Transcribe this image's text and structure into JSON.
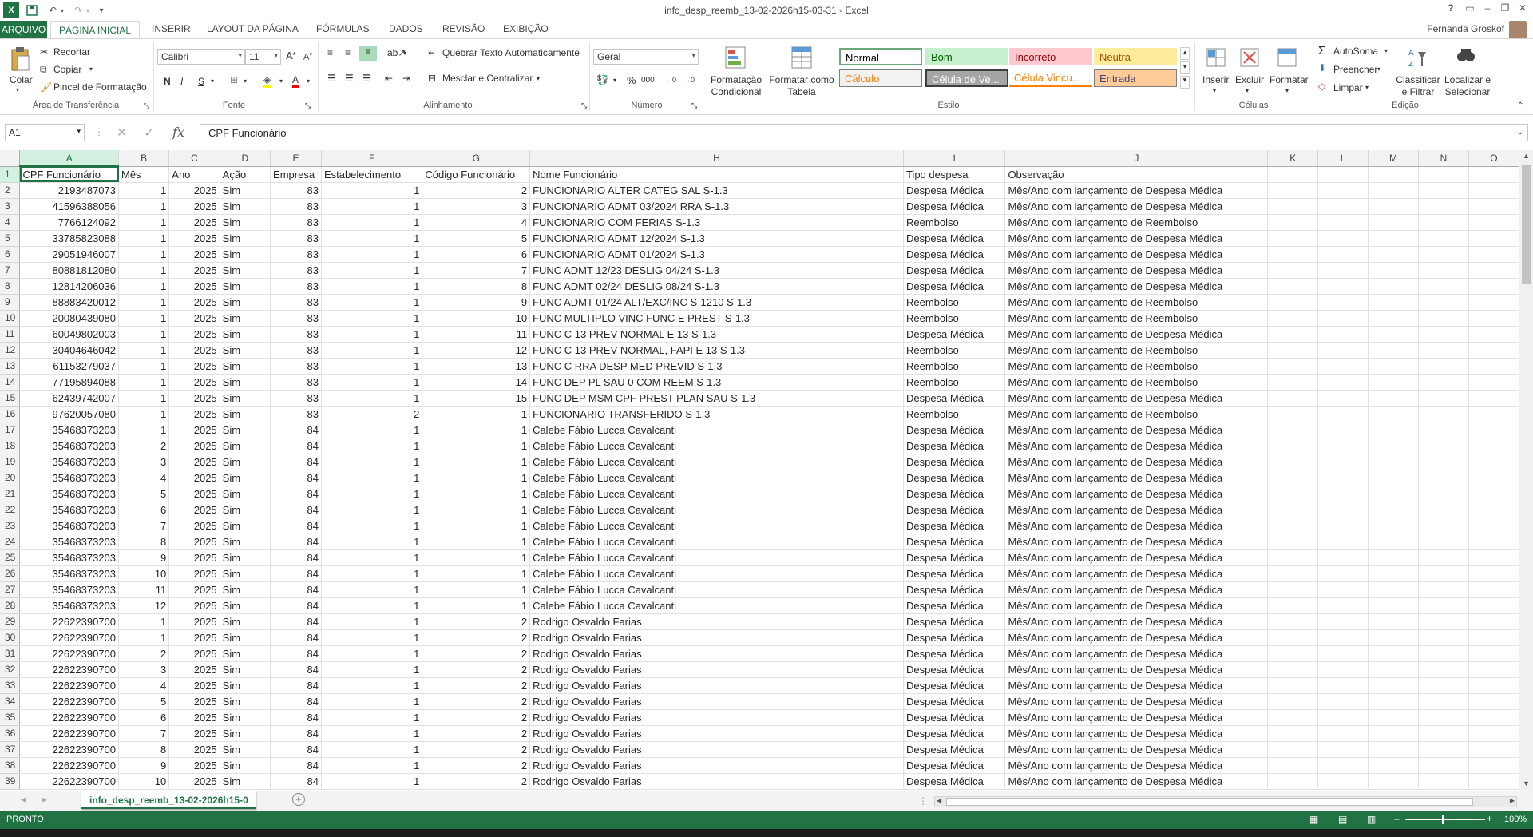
{
  "window": {
    "title": "info_desp_reemb_13-02-2026h15-03-31 - Excel",
    "user": "Fernanda Groskof",
    "help": "?"
  },
  "tabs": {
    "file": "ARQUIVO",
    "items": [
      "PÁGINA INICIAL",
      "INSERIR",
      "LAYOUT DA PÁGINA",
      "FÓRMULAS",
      "DADOS",
      "REVISÃO",
      "EXIBIÇÃO"
    ]
  },
  "ribbon": {
    "clipboard": {
      "paste": "Colar",
      "cut": "Recortar",
      "copy": "Copiar",
      "painter": "Pincel de Formatação",
      "label": "Área de Transferência"
    },
    "font": {
      "name": "Calibri",
      "size": "11",
      "bold": "N",
      "italic": "I",
      "underline": "S",
      "label": "Fonte"
    },
    "alignment": {
      "wrap": "Quebrar Texto Automaticamente",
      "merge": "Mesclar e Centralizar",
      "label": "Alinhamento"
    },
    "number": {
      "format": "Geral",
      "label": "Número",
      "percent": "%",
      "thousands": "000"
    },
    "styles": {
      "conditional": "Formatação Condicional",
      "table": "Formatar como Tabela",
      "boxes": [
        {
          "label": "Normal",
          "bg": "#ffffff",
          "fg": "#000000",
          "border": "#6aa87a"
        },
        {
          "label": "Bom",
          "bg": "#c6efce",
          "fg": "#006100",
          "border": "#c6efce"
        },
        {
          "label": "Incorreto",
          "bg": "#ffc7ce",
          "fg": "#9c0006",
          "border": "#ffc7ce"
        },
        {
          "label": "Neutra",
          "bg": "#ffeb9c",
          "fg": "#9c5700",
          "border": "#ffeb9c"
        },
        {
          "label": "Cálculo",
          "bg": "#f2f2f2",
          "fg": "#fa7d00",
          "border": "#7f7f7f"
        },
        {
          "label": "Célula de Ve...",
          "bg": "#a5a5a5",
          "fg": "#ffffff",
          "border": "#3f3f3f"
        },
        {
          "label": "Célula Vincu...",
          "bg": "#ffffff",
          "fg": "#fa7d00",
          "border": "#ff8001"
        },
        {
          "label": "Entrada",
          "bg": "#ffcc99",
          "fg": "#3f3f76",
          "border": "#7f7f7f"
        }
      ],
      "label": "Estilo"
    },
    "cells": {
      "insert": "Inserir",
      "delete": "Excluir",
      "format": "Formatar",
      "label": "Células"
    },
    "editing": {
      "autosum": "AutoSoma",
      "fill": "Preencher",
      "clear": "Limpar",
      "sort": "Classificar e Filtrar",
      "find": "Localizar e Selecionar",
      "label": "Edição"
    }
  },
  "formula_bar": {
    "name_box": "A1",
    "fx": "fx",
    "content": "CPF Funcionário"
  },
  "columns": [
    "A",
    "B",
    "C",
    "D",
    "E",
    "F",
    "G",
    "H",
    "I",
    "J",
    "K",
    "L",
    "M",
    "N",
    "O"
  ],
  "header_row": [
    "CPF Funcionário",
    "Mês",
    "Ano",
    "Ação",
    "Empresa",
    "Estabelecimento",
    "Código Funcionário",
    "Nome Funcionário",
    "Tipo despesa",
    "Observação"
  ],
  "rows": [
    [
      "2193487073",
      "1",
      "2025",
      "Sim",
      "83",
      "1",
      "2",
      "FUNCIONARIO ALTER CATEG SAL  S-1.3",
      "Despesa Médica",
      "Mês/Ano com lançamento de Despesa Médica"
    ],
    [
      "41596388056",
      "1",
      "2025",
      "Sim",
      "83",
      "1",
      "3",
      "FUNCIONARIO ADMT  03/2024 RRA S-1.3",
      "Despesa Médica",
      "Mês/Ano com lançamento de Despesa Médica"
    ],
    [
      "7766124092",
      "1",
      "2025",
      "Sim",
      "83",
      "1",
      "4",
      "FUNCIONARIO COM FERIAS S-1.3",
      "Reembolso",
      "Mês/Ano com lançamento de Reembolso"
    ],
    [
      "33785823088",
      "1",
      "2025",
      "Sim",
      "83",
      "1",
      "5",
      "FUNCIONARIO ADMT 12/2024  S-1.3",
      "Despesa Médica",
      "Mês/Ano com lançamento de Despesa Médica"
    ],
    [
      "29051946007",
      "1",
      "2025",
      "Sim",
      "83",
      "1",
      "6",
      "FUNCIONARIO ADMT 01/2024  S-1.3",
      "Despesa Médica",
      "Mês/Ano com lançamento de Despesa Médica"
    ],
    [
      "80881812080",
      "1",
      "2025",
      "Sim",
      "83",
      "1",
      "7",
      "FUNC ADMT 12/23 DESLIG 04/24  S-1.3",
      "Despesa Médica",
      "Mês/Ano com lançamento de Despesa Médica"
    ],
    [
      "12814206036",
      "1",
      "2025",
      "Sim",
      "83",
      "1",
      "8",
      "FUNC ADMT 02/24 DESLIG 08/24  S-1.3",
      "Despesa Médica",
      "Mês/Ano com lançamento de Despesa Médica"
    ],
    [
      "88883420012",
      "1",
      "2025",
      "Sim",
      "83",
      "1",
      "9",
      "FUNC ADMT 01/24 ALT/EXC/INC S-1210 S-1.3",
      "Reembolso",
      "Mês/Ano com lançamento de Reembolso"
    ],
    [
      "20080439080",
      "1",
      "2025",
      "Sim",
      "83",
      "1",
      "10",
      "FUNC MULTIPLO VINC FUNC E PREST  S-1.3",
      "Reembolso",
      "Mês/Ano com lançamento de Reembolso"
    ],
    [
      "60049802003",
      "1",
      "2025",
      "Sim",
      "83",
      "1",
      "11",
      "FUNC C 13 PREV NORMAL E 13  S-1.3",
      "Despesa Médica",
      "Mês/Ano com lançamento de Despesa Médica"
    ],
    [
      "30404646042",
      "1",
      "2025",
      "Sim",
      "83",
      "1",
      "12",
      "FUNC C 13 PREV NORMAL, FAPI  E 13  S-1.3",
      "Reembolso",
      "Mês/Ano com lançamento de Reembolso"
    ],
    [
      "61153279037",
      "1",
      "2025",
      "Sim",
      "83",
      "1",
      "13",
      "FUNC C RRA DESP MED PREVID  S-1.3",
      "Reembolso",
      "Mês/Ano com lançamento de Reembolso"
    ],
    [
      "77195894088",
      "1",
      "2025",
      "Sim",
      "83",
      "1",
      "14",
      "FUNC DEP PL SAU 0 COM  REEM  S-1.3",
      "Reembolso",
      "Mês/Ano com lançamento de Reembolso"
    ],
    [
      "62439742007",
      "1",
      "2025",
      "Sim",
      "83",
      "1",
      "15",
      "FUNC DEP MSM CPF PREST PLAN SAU  S-1.3",
      "Despesa Médica",
      "Mês/Ano com lançamento de Despesa Médica"
    ],
    [
      "97620057080",
      "1",
      "2025",
      "Sim",
      "83",
      "2",
      "1",
      "FUNCIONARIO TRANSFERIDO S-1.3",
      "Reembolso",
      "Mês/Ano com lançamento de Reembolso"
    ],
    [
      "35468373203",
      "1",
      "2025",
      "Sim",
      "84",
      "1",
      "1",
      "Calebe Fábio Lucca Cavalcanti",
      "Despesa Médica",
      "Mês/Ano com lançamento de Despesa Médica"
    ],
    [
      "35468373203",
      "2",
      "2025",
      "Sim",
      "84",
      "1",
      "1",
      "Calebe Fábio Lucca Cavalcanti",
      "Despesa Médica",
      "Mês/Ano com lançamento de Despesa Médica"
    ],
    [
      "35468373203",
      "3",
      "2025",
      "Sim",
      "84",
      "1",
      "1",
      "Calebe Fábio Lucca Cavalcanti",
      "Despesa Médica",
      "Mês/Ano com lançamento de Despesa Médica"
    ],
    [
      "35468373203",
      "4",
      "2025",
      "Sim",
      "84",
      "1",
      "1",
      "Calebe Fábio Lucca Cavalcanti",
      "Despesa Médica",
      "Mês/Ano com lançamento de Despesa Médica"
    ],
    [
      "35468373203",
      "5",
      "2025",
      "Sim",
      "84",
      "1",
      "1",
      "Calebe Fábio Lucca Cavalcanti",
      "Despesa Médica",
      "Mês/Ano com lançamento de Despesa Médica"
    ],
    [
      "35468373203",
      "6",
      "2025",
      "Sim",
      "84",
      "1",
      "1",
      "Calebe Fábio Lucca Cavalcanti",
      "Despesa Médica",
      "Mês/Ano com lançamento de Despesa Médica"
    ],
    [
      "35468373203",
      "7",
      "2025",
      "Sim",
      "84",
      "1",
      "1",
      "Calebe Fábio Lucca Cavalcanti",
      "Despesa Médica",
      "Mês/Ano com lançamento de Despesa Médica"
    ],
    [
      "35468373203",
      "8",
      "2025",
      "Sim",
      "84",
      "1",
      "1",
      "Calebe Fábio Lucca Cavalcanti",
      "Despesa Médica",
      "Mês/Ano com lançamento de Despesa Médica"
    ],
    [
      "35468373203",
      "9",
      "2025",
      "Sim",
      "84",
      "1",
      "1",
      "Calebe Fábio Lucca Cavalcanti",
      "Despesa Médica",
      "Mês/Ano com lançamento de Despesa Médica"
    ],
    [
      "35468373203",
      "10",
      "2025",
      "Sim",
      "84",
      "1",
      "1",
      "Calebe Fábio Lucca Cavalcanti",
      "Despesa Médica",
      "Mês/Ano com lançamento de Despesa Médica"
    ],
    [
      "35468373203",
      "11",
      "2025",
      "Sim",
      "84",
      "1",
      "1",
      "Calebe Fábio Lucca Cavalcanti",
      "Despesa Médica",
      "Mês/Ano com lançamento de Despesa Médica"
    ],
    [
      "35468373203",
      "12",
      "2025",
      "Sim",
      "84",
      "1",
      "1",
      "Calebe Fábio Lucca Cavalcanti",
      "Despesa Médica",
      "Mês/Ano com lançamento de Despesa Médica"
    ],
    [
      "22622390700",
      "1",
      "2025",
      "Sim",
      "84",
      "1",
      "2",
      "Rodrigo Osvaldo Farias",
      "Despesa Médica",
      "Mês/Ano com lançamento de Despesa Médica"
    ],
    [
      "22622390700",
      "1",
      "2025",
      "Sim",
      "84",
      "1",
      "2",
      "Rodrigo Osvaldo Farias",
      "Despesa Médica",
      "Mês/Ano com lançamento de Despesa Médica"
    ],
    [
      "22622390700",
      "2",
      "2025",
      "Sim",
      "84",
      "1",
      "2",
      "Rodrigo Osvaldo Farias",
      "Despesa Médica",
      "Mês/Ano com lançamento de Despesa Médica"
    ],
    [
      "22622390700",
      "3",
      "2025",
      "Sim",
      "84",
      "1",
      "2",
      "Rodrigo Osvaldo Farias",
      "Despesa Médica",
      "Mês/Ano com lançamento de Despesa Médica"
    ],
    [
      "22622390700",
      "4",
      "2025",
      "Sim",
      "84",
      "1",
      "2",
      "Rodrigo Osvaldo Farias",
      "Despesa Médica",
      "Mês/Ano com lançamento de Despesa Médica"
    ],
    [
      "22622390700",
      "5",
      "2025",
      "Sim",
      "84",
      "1",
      "2",
      "Rodrigo Osvaldo Farias",
      "Despesa Médica",
      "Mês/Ano com lançamento de Despesa Médica"
    ],
    [
      "22622390700",
      "6",
      "2025",
      "Sim",
      "84",
      "1",
      "2",
      "Rodrigo Osvaldo Farias",
      "Despesa Médica",
      "Mês/Ano com lançamento de Despesa Médica"
    ],
    [
      "22622390700",
      "7",
      "2025",
      "Sim",
      "84",
      "1",
      "2",
      "Rodrigo Osvaldo Farias",
      "Despesa Médica",
      "Mês/Ano com lançamento de Despesa Médica"
    ],
    [
      "22622390700",
      "8",
      "2025",
      "Sim",
      "84",
      "1",
      "2",
      "Rodrigo Osvaldo Farias",
      "Despesa Médica",
      "Mês/Ano com lançamento de Despesa Médica"
    ],
    [
      "22622390700",
      "9",
      "2025",
      "Sim",
      "84",
      "1",
      "2",
      "Rodrigo Osvaldo Farias",
      "Despesa Médica",
      "Mês/Ano com lançamento de Despesa Médica"
    ],
    [
      "22622390700",
      "10",
      "2025",
      "Sim",
      "84",
      "1",
      "2",
      "Rodrigo Osvaldo Farias",
      "Despesa Médica",
      "Mês/Ano com lançamento de Despesa Médica"
    ]
  ],
  "sheet": {
    "tab": "info_desp_reemb_13-02-2026h15-0"
  },
  "status": {
    "ready": "PRONTO",
    "zoom": "100%"
  }
}
